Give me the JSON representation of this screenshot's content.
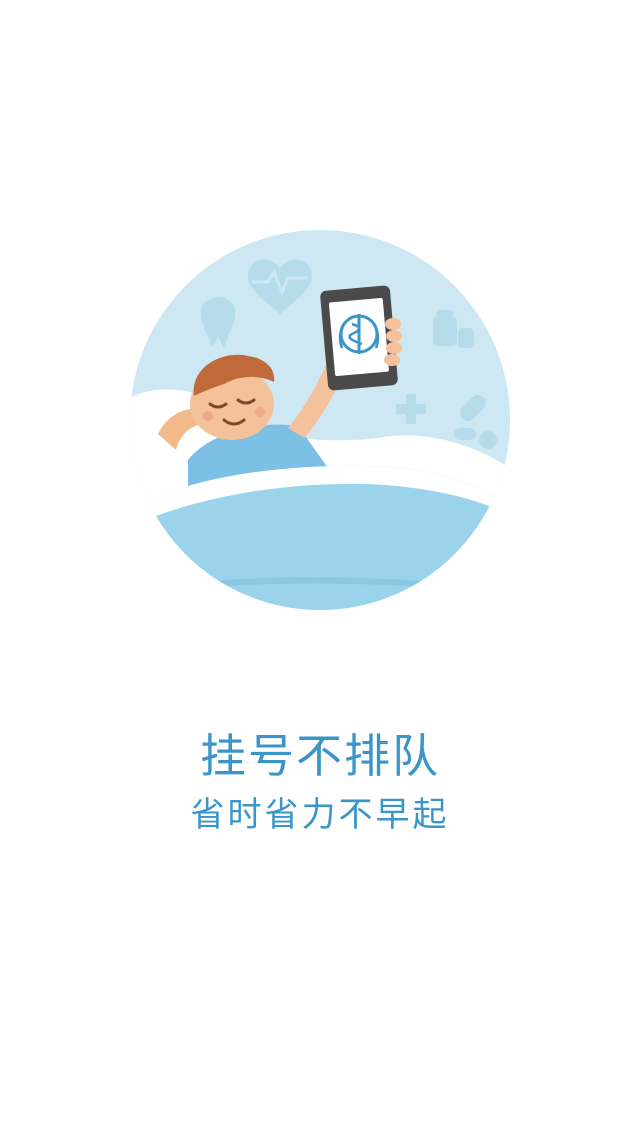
{
  "splash": {
    "headline": "挂号不排队",
    "subline": "省时省力不早起"
  },
  "colors": {
    "accent": "#3a95c8",
    "circle_bg": "#cde8f3",
    "blanket": "#9ad3ea",
    "icon_faint": "#b6dcec"
  },
  "icons": {
    "illustration": "person-in-bed-with-phone-illustration",
    "heart_monitor": "heart-monitor-icon",
    "tooth": "tooth-icon",
    "medicine_bottle": "medicine-bottle-icon",
    "pills": "pills-icon",
    "medical_cross": "medical-cross-icon",
    "health_emblem": "health-emblem-icon"
  }
}
